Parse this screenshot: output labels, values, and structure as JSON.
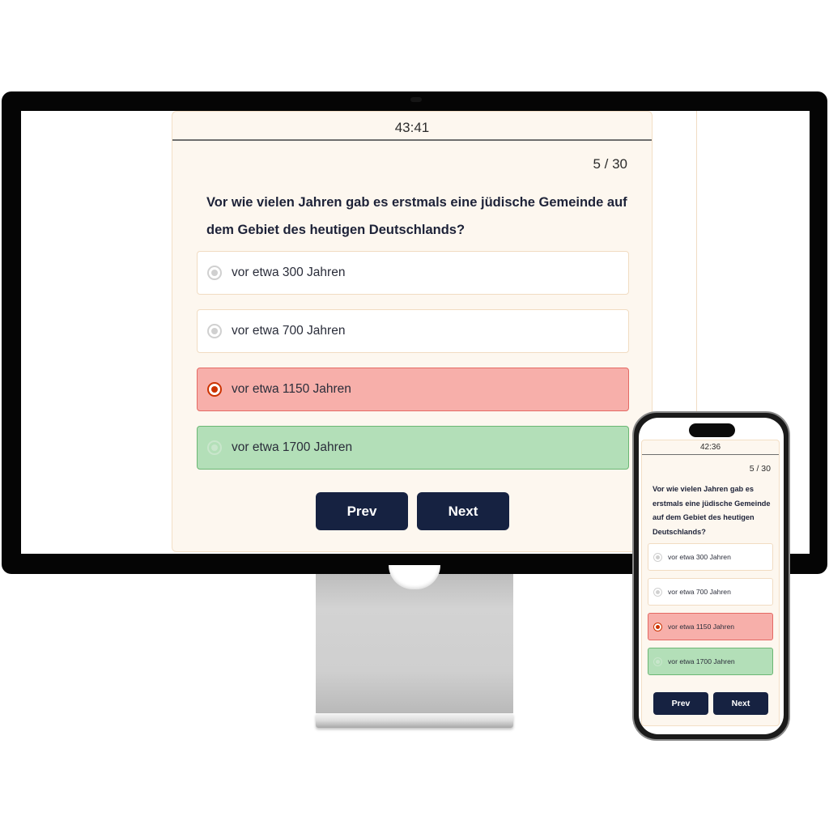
{
  "desktop": {
    "timer": "43:41",
    "counter": "5 / 30",
    "question": "Vor wie vielen Jahren gab es erstmals eine jüdische Gemeinde auf dem Gebiet des heutigen Deutschlands?",
    "options": [
      {
        "label": "vor etwa 300 Jahren",
        "state": "neutral"
      },
      {
        "label": "vor etwa 700 Jahren",
        "state": "neutral"
      },
      {
        "label": "vor etwa 1150 Jahren",
        "state": "wrong-selected"
      },
      {
        "label": "vor etwa 1700 Jahren",
        "state": "correct"
      }
    ],
    "prev_label": "Prev",
    "next_label": "Next"
  },
  "mobile": {
    "timer": "42:36",
    "counter": "5 / 30",
    "question": "Vor wie vielen Jahren gab es erstmals eine jüdische Gemeinde auf dem Gebiet des heutigen Deutschlands?",
    "options": [
      {
        "label": "vor etwa 300 Jahren",
        "state": "neutral"
      },
      {
        "label": "vor etwa 700 Jahren",
        "state": "neutral"
      },
      {
        "label": "vor etwa 1150 Jahren",
        "state": "wrong-selected"
      },
      {
        "label": "vor etwa 1700 Jahren",
        "state": "correct"
      }
    ],
    "prev_label": "Prev",
    "next_label": "Next"
  },
  "colors": {
    "card_bg": "#fdf7ef",
    "button_bg": "#162241",
    "wrong_bg": "#f7afaa",
    "correct_bg": "#b3dfb8",
    "selected_radio": "#cc3300"
  }
}
